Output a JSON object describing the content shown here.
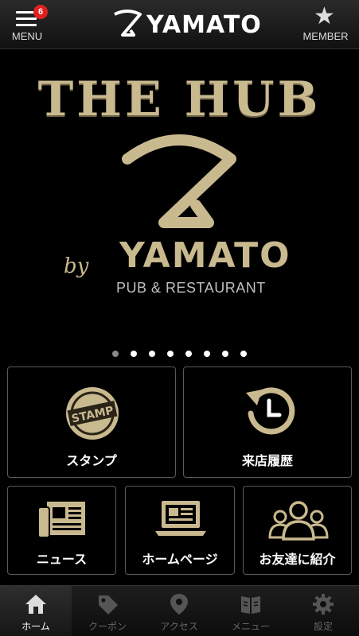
{
  "header": {
    "menu_label": "MENU",
    "menu_badge": "6",
    "logo_text": "YAMATO",
    "member_label": "MEMBER"
  },
  "hero": {
    "title": "THE HUB",
    "by": "by",
    "brand": "YAMATO",
    "subtitle": "PUB & RESTAURANT",
    "slide_count": 8,
    "active_slide": 0
  },
  "tiles": {
    "stamp": {
      "label": "スタンプ",
      "icon_text": "STAMP"
    },
    "history": {
      "label": "来店履歴"
    },
    "news": {
      "label": "ニュース"
    },
    "homepage": {
      "label": "ホームページ"
    },
    "invite": {
      "label": "お友達に紹介"
    }
  },
  "tabbar": {
    "home": "ホーム",
    "coupon": "クーポン",
    "access": "アクセス",
    "menu": "メニュー",
    "settings": "設定"
  },
  "colors": {
    "gold": "#c9b98f",
    "badge": "#e02020",
    "inactive_tab": "#666666"
  }
}
